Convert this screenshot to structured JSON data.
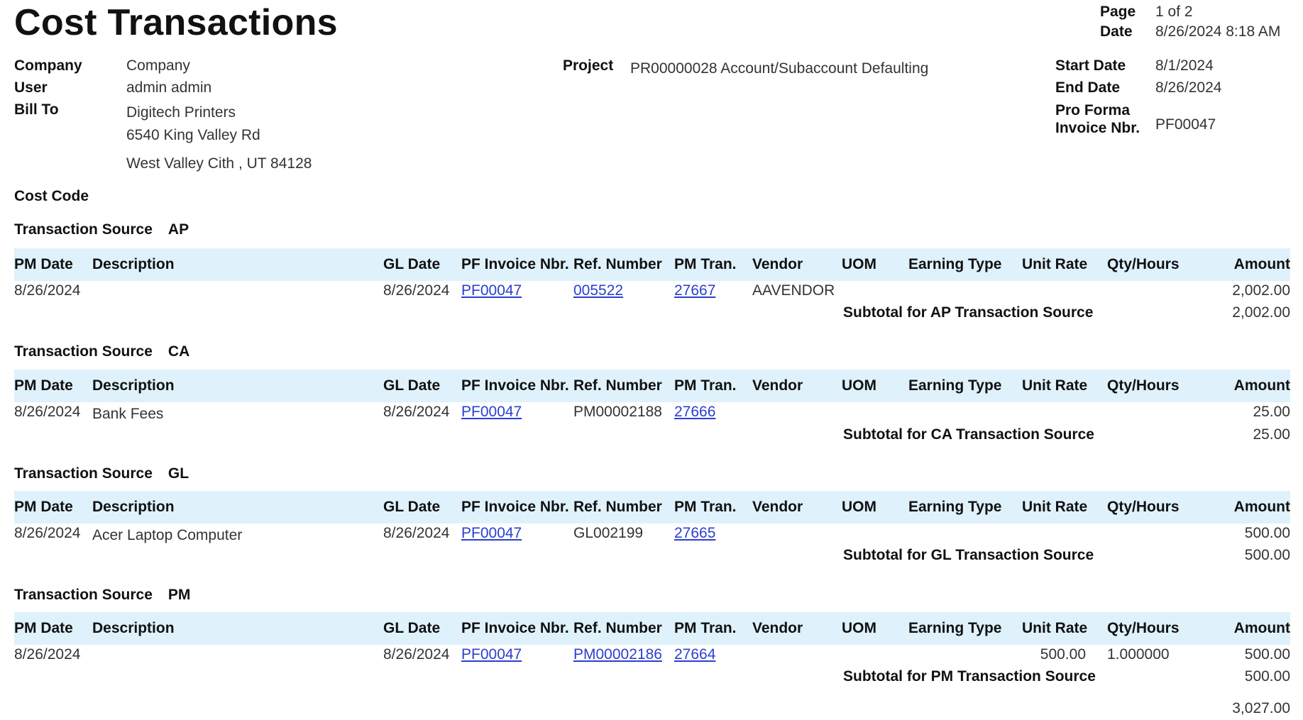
{
  "report": {
    "title": "Cost Transactions",
    "page_label": "Page",
    "page_value": "1 of 2",
    "date_label": "Date",
    "date_value": "8/26/2024 8:18 AM"
  },
  "header": {
    "company_label": "Company",
    "company_value": "Company",
    "user_label": "User",
    "user_value": "admin admin",
    "bill_to_label": "Bill To",
    "bill_to_line1": "Digitech Printers",
    "bill_to_line2": "6540 King Valley Rd",
    "bill_to_line3": "West Valley Cith , UT 84128",
    "project_label": "Project",
    "project_value": "PR00000028 Account/Subaccount Defaulting",
    "start_date_label": "Start Date",
    "start_date_value": "8/1/2024",
    "end_date_label": "End Date",
    "end_date_value": "8/26/2024",
    "pro_forma_label_line1": "Pro Forma",
    "pro_forma_label_line2": "Invoice Nbr.",
    "pro_forma_value": "PF00047",
    "cost_code_label": "Cost Code"
  },
  "columns": {
    "pm_date": "PM Date",
    "description": "Description",
    "gl_date": "GL Date",
    "pf_invoice": "PF Invoice Nbr.",
    "ref_number": "Ref. Number",
    "pm_tran": "PM Tran.",
    "vendor": "Vendor",
    "uom": "UOM",
    "earning_type": "Earning Type",
    "unit_rate": "Unit Rate",
    "qty_hours": "Qty/Hours",
    "amount": "Amount"
  },
  "source_label": "Transaction Source",
  "sections": [
    {
      "source": "AP",
      "row": {
        "pm_date": "8/26/2024",
        "description": "",
        "gl_date": "8/26/2024",
        "pf_invoice": "PF00047",
        "ref_number": "005522",
        "pm_tran": "27667",
        "vendor": "AAVENDOR",
        "uom": "",
        "earning_type": "",
        "unit_rate": "",
        "qty_hours": "",
        "amount": "2,002.00"
      },
      "subtotal_label": "Subtotal for AP Transaction Source",
      "subtotal_value": "2,002.00"
    },
    {
      "source": "CA",
      "row": {
        "pm_date": "8/26/2024",
        "description": "Bank Fees",
        "gl_date": "8/26/2024",
        "pf_invoice": "PF00047",
        "ref_number": "PM00002188",
        "pm_tran": "27666",
        "vendor": "",
        "uom": "",
        "earning_type": "",
        "unit_rate": "",
        "qty_hours": "",
        "amount": "25.00"
      },
      "subtotal_label": "Subtotal for CA Transaction Source",
      "subtotal_value": "25.00"
    },
    {
      "source": "GL",
      "row": {
        "pm_date": "8/26/2024",
        "description": "Acer Laptop Computer",
        "gl_date": "8/26/2024",
        "pf_invoice": "PF00047",
        "ref_number": "GL002199",
        "pm_tran": "27665",
        "vendor": "",
        "uom": "",
        "earning_type": "",
        "unit_rate": "",
        "qty_hours": "",
        "amount": "500.00"
      },
      "subtotal_label": "Subtotal for GL Transaction Source",
      "subtotal_value": "500.00"
    },
    {
      "source": "PM",
      "row": {
        "pm_date": "8/26/2024",
        "description": "",
        "gl_date": "8/26/2024",
        "pf_invoice": "PF00047",
        "ref_number": "PM00002186",
        "pm_tran": "27664",
        "vendor": "",
        "uom": "",
        "earning_type": "",
        "unit_rate": "500.00",
        "qty_hours": "1.000000",
        "amount": "500.00"
      },
      "subtotal_label": "Subtotal for PM Transaction Source",
      "subtotal_value": "500.00"
    }
  ],
  "grand_total": "3,027.00",
  "colors": {
    "header_band": "#dff1fb",
    "link": "#2a3fd0"
  }
}
